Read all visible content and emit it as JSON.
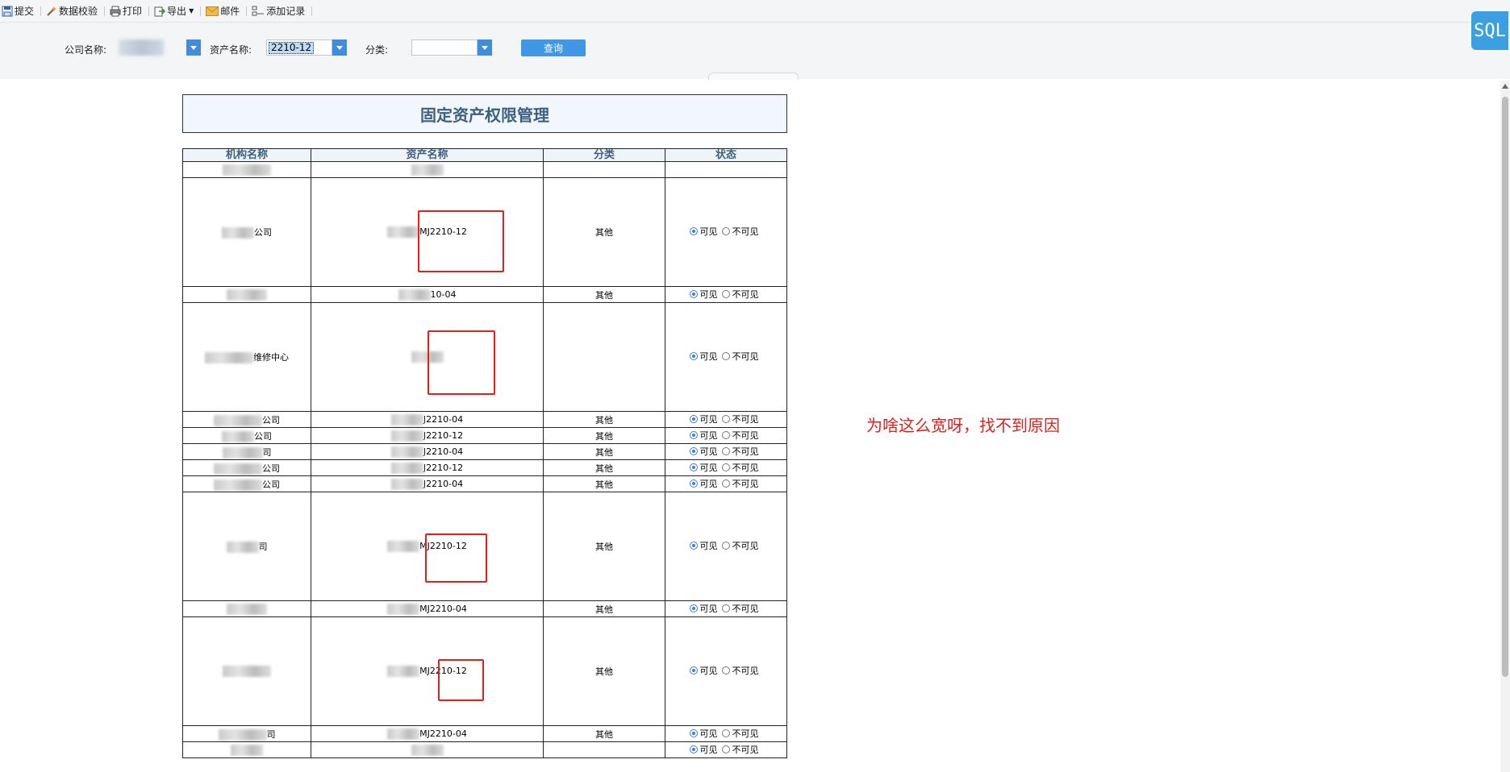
{
  "toolbar": {
    "submit": "提交",
    "validate": "数据校验",
    "print": "打印",
    "export": "导出",
    "mail": "邮件",
    "add_record": "添加记录"
  },
  "query": {
    "company_label": "公司名称:",
    "asset_label": "资产名称:",
    "asset_value": "2210-12",
    "category_label": "分类:",
    "category_value": "",
    "search_button": "查询"
  },
  "sql_badge": "SQL",
  "report": {
    "title": "固定资产权限管理",
    "headers": [
      "机构名称",
      "资产名称",
      "分类",
      "状态"
    ],
    "visible_label": "可见",
    "invisible_label": "不可见",
    "rows": [
      {
        "org": "",
        "asset": "",
        "category": "",
        "tall": false,
        "status_on": false
      },
      {
        "org": "公司",
        "asset": "MJ2210-12",
        "category": "其他",
        "tall": true,
        "status_on": true
      },
      {
        "org": "",
        "asset": "10-04",
        "category": "其他",
        "tall": false,
        "status_on": true
      },
      {
        "org": "维修中心",
        "asset": "",
        "category": "",
        "tall": true,
        "status_on": true
      },
      {
        "org": "公司",
        "asset": "J2210-04",
        "category": "其他",
        "tall": false,
        "status_on": true
      },
      {
        "org": "公司",
        "asset": "J2210-12",
        "category": "其他",
        "tall": false,
        "status_on": true
      },
      {
        "org": "司",
        "asset": "J2210-04",
        "category": "其他",
        "tall": false,
        "status_on": true
      },
      {
        "org": "公司",
        "asset": "J2210-12",
        "category": "其他",
        "tall": false,
        "status_on": true
      },
      {
        "org": "公司",
        "asset": "J2210-04",
        "category": "其他",
        "tall": false,
        "status_on": true
      },
      {
        "org": "司",
        "asset": "MJ2210-12",
        "category": "其他",
        "tall": true,
        "status_on": true
      },
      {
        "org": "",
        "asset": "MJ2210-04",
        "category": "其他",
        "tall": false,
        "status_on": true
      },
      {
        "org": "",
        "asset": "MJ2210-12",
        "category": "其他",
        "tall": true,
        "status_on": true
      },
      {
        "org": "司",
        "asset": "MJ2210-04",
        "category": "其他",
        "tall": false,
        "status_on": true
      },
      {
        "org": "",
        "asset": "",
        "category": "",
        "tall": false,
        "status_on": true
      }
    ]
  },
  "annotation": "为啥这么宽呀，找不到原因",
  "colors": {
    "accent": "#3f97e6",
    "title_text": "#3d6080",
    "annotation": "#e0201b"
  }
}
